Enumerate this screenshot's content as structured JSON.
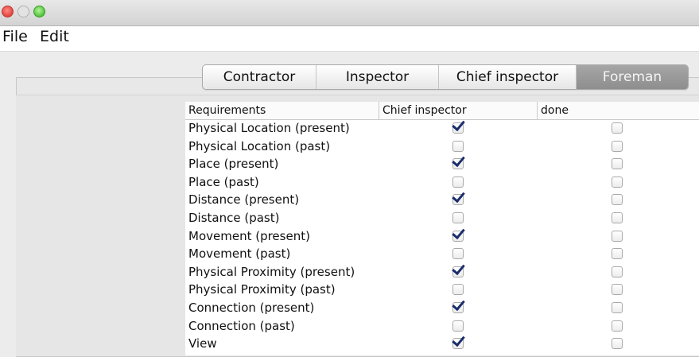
{
  "menu": {
    "file": "File",
    "edit": "Edit"
  },
  "tabs": [
    "Contractor",
    "Inspector",
    "Chief inspector",
    "Foreman"
  ],
  "selected_tab": "Foreman",
  "table": {
    "headers": [
      "Requirements",
      "Chief inspector",
      "done"
    ],
    "rows": [
      {
        "label": "Physical Location (present)",
        "chief": true,
        "done": false
      },
      {
        "label": "Physical Location (past)",
        "chief": false,
        "done": false
      },
      {
        "label": "Place (present)",
        "chief": true,
        "done": false
      },
      {
        "label": "Place (past)",
        "chief": false,
        "done": false
      },
      {
        "label": "Distance (present)",
        "chief": true,
        "done": false
      },
      {
        "label": "Distance (past)",
        "chief": false,
        "done": false
      },
      {
        "label": "Movement (present)",
        "chief": true,
        "done": false
      },
      {
        "label": "Movement (past)",
        "chief": false,
        "done": false
      },
      {
        "label": "Physical Proximity (present)",
        "chief": true,
        "done": false
      },
      {
        "label": "Physical Proximity (past)",
        "chief": false,
        "done": false
      },
      {
        "label": "Connection (present)",
        "chief": true,
        "done": false
      },
      {
        "label": "Connection (past)",
        "chief": false,
        "done": false
      },
      {
        "label": "View",
        "chief": true,
        "done": false
      }
    ]
  },
  "colors": {
    "close": "#e0443e",
    "maximize": "#4fc33a",
    "selected_tab_bg": "#9a9a9a",
    "checkmark": "#1a2d6b"
  }
}
